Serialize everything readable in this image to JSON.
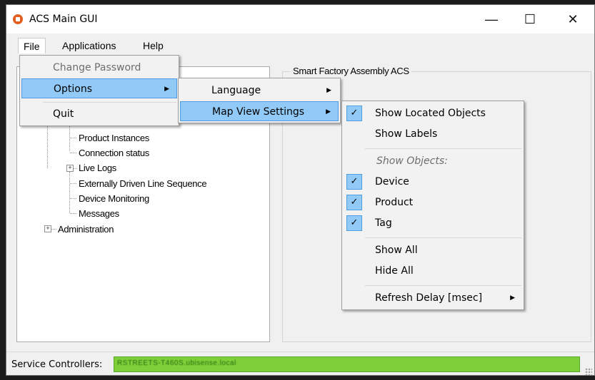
{
  "window": {
    "title": "ACS Main GUI",
    "minimize": "—",
    "maximize": "☐",
    "close": "✕"
  },
  "menubar": {
    "file": "File",
    "applications": "Applications",
    "help": "Help"
  },
  "file_menu": {
    "change_password": "Change Password",
    "options": "Options",
    "quit": "Quit"
  },
  "options_menu": {
    "language": "Language",
    "map_view_settings": "Map View Settings"
  },
  "map_view_menu": {
    "show_located_objects": "Show Located Objects",
    "show_labels": "Show Labels",
    "show_objects_header": "Show Objects:",
    "device": "Device",
    "product": "Product",
    "tag": "Tag",
    "show_all": "Show All",
    "hide_all": "Hide All",
    "refresh_delay": "Refresh Delay [msec]"
  },
  "checks": {
    "show_located_objects": true,
    "device": true,
    "product": true,
    "tag": true
  },
  "tree": {
    "product_instances": "Product Instances",
    "connection_status": "Connection status",
    "live_logs": "Live Logs",
    "externally_driven": "Externally Driven Line Sequence",
    "device_monitoring": "Device Monitoring",
    "messages": "Messages",
    "administration": "Administration"
  },
  "group": {
    "label": "Smart Factory Assembly ACS"
  },
  "status": {
    "label": "Service Controllers:",
    "value": "RSTREETS-T460S.ubisense.local",
    "color": "#7ed03a"
  },
  "colors": {
    "highlight": "#91c9f7",
    "accent": "#e1601f"
  }
}
